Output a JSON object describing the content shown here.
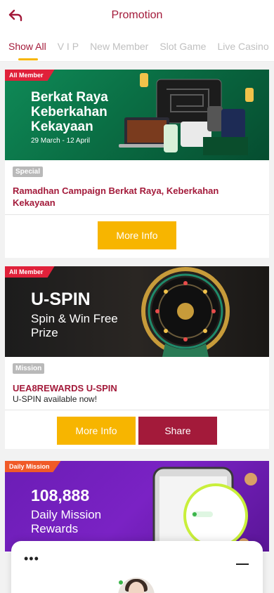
{
  "header": {
    "title": "Promotion"
  },
  "tabs": [
    "Show All",
    "V I P",
    "New Member",
    "Slot Game",
    "Live Casino"
  ],
  "promos": [
    {
      "ribbon": "All Member",
      "banner_lines": [
        "Berkat Raya",
        "Keberkahan",
        "Kekayaan"
      ],
      "banner_dates": "29 March - 12 April",
      "tag": "Special",
      "title": "Ramadhan Campaign Berkat Raya, Keberkahan Kekayaan",
      "more_info": "More Info"
    },
    {
      "ribbon": "All Member",
      "banner_lines": [
        "U-SPIN",
        "Spin & Win Free",
        "Prize"
      ],
      "tag": "Mission",
      "title": "UEA8REWARDS U-SPIN",
      "description": "U-SPIN available now!",
      "more_info": "More Info",
      "share": "Share"
    },
    {
      "ribbon": "Daily Mission",
      "banner_lines": [
        "108,888",
        "Daily Mission",
        "Rewards"
      ]
    }
  ],
  "colors": {
    "brand": "#a31a3a",
    "accent": "#f7b500",
    "tab_inactive": "#c0c0c0"
  }
}
